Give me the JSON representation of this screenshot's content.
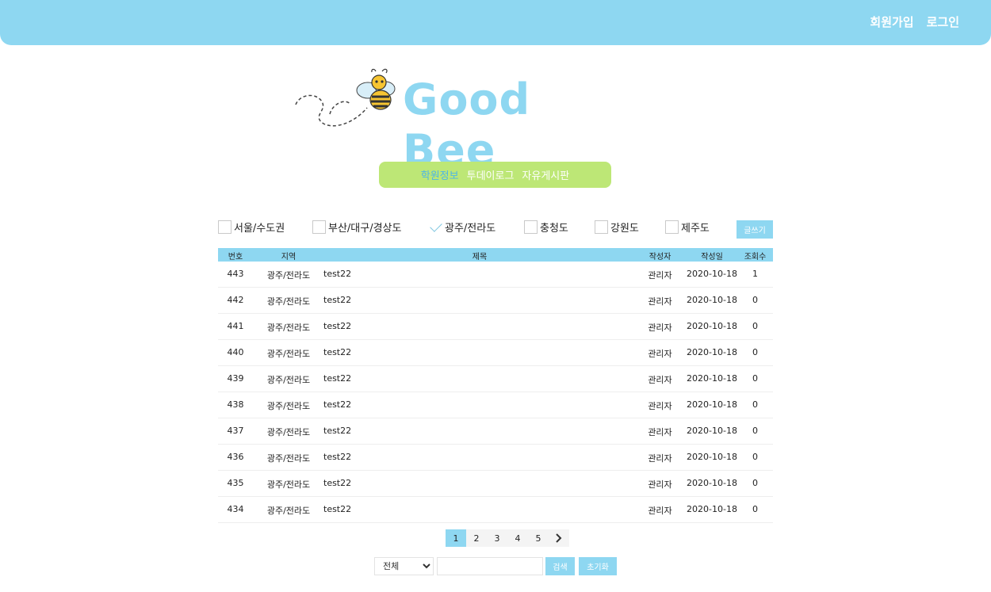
{
  "header": {
    "signup": "회원가입",
    "login": "로그인"
  },
  "logo": {
    "text": "Good Bee"
  },
  "nav": {
    "items": [
      "학원정보",
      "투데이로그",
      "자유게시판"
    ],
    "active_index": 0
  },
  "filters": [
    {
      "label": "서울/수도권",
      "checked": false
    },
    {
      "label": "부산/대구/경상도",
      "checked": false
    },
    {
      "label": "광주/전라도",
      "checked": true
    },
    {
      "label": "충청도",
      "checked": false
    },
    {
      "label": "강원도",
      "checked": false
    },
    {
      "label": "제주도",
      "checked": false
    }
  ],
  "write_button": "글쓰기",
  "table": {
    "headers": {
      "num": "번호",
      "region": "지역",
      "title": "제목",
      "author": "작성자",
      "date": "작성일",
      "views": "조회수"
    },
    "rows": [
      {
        "num": "443",
        "region": "광주/전라도",
        "title": "test22",
        "author": "관리자",
        "date": "2020-10-18",
        "views": "1"
      },
      {
        "num": "442",
        "region": "광주/전라도",
        "title": "test22",
        "author": "관리자",
        "date": "2020-10-18",
        "views": "0"
      },
      {
        "num": "441",
        "region": "광주/전라도",
        "title": "test22",
        "author": "관리자",
        "date": "2020-10-18",
        "views": "0"
      },
      {
        "num": "440",
        "region": "광주/전라도",
        "title": "test22",
        "author": "관리자",
        "date": "2020-10-18",
        "views": "0"
      },
      {
        "num": "439",
        "region": "광주/전라도",
        "title": "test22",
        "author": "관리자",
        "date": "2020-10-18",
        "views": "0"
      },
      {
        "num": "438",
        "region": "광주/전라도",
        "title": "test22",
        "author": "관리자",
        "date": "2020-10-18",
        "views": "0"
      },
      {
        "num": "437",
        "region": "광주/전라도",
        "title": "test22",
        "author": "관리자",
        "date": "2020-10-18",
        "views": "0"
      },
      {
        "num": "436",
        "region": "광주/전라도",
        "title": "test22",
        "author": "관리자",
        "date": "2020-10-18",
        "views": "0"
      },
      {
        "num": "435",
        "region": "광주/전라도",
        "title": "test22",
        "author": "관리자",
        "date": "2020-10-18",
        "views": "0"
      },
      {
        "num": "434",
        "region": "광주/전라도",
        "title": "test22",
        "author": "관리자",
        "date": "2020-10-18",
        "views": "0"
      }
    ]
  },
  "pagination": {
    "pages": [
      "1",
      "2",
      "3",
      "4",
      "5"
    ],
    "current": "1",
    "next_icon": "chevron-right-icon"
  },
  "search": {
    "select_value": "전체",
    "input_value": "",
    "search_button": "검색",
    "reset_button": "초기화"
  },
  "colors": {
    "sky": "#8ed7f1",
    "green": "#bde776",
    "active_nav": "#4fb6e4",
    "bee_yellow": "#f6c532"
  }
}
